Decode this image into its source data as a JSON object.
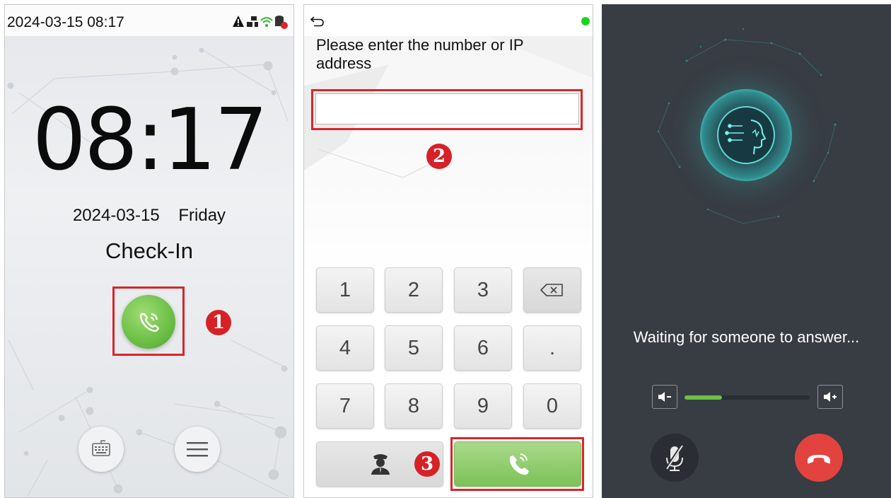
{
  "panel1": {
    "status_datetime": "2024-03-15 08:17",
    "status_icons": [
      "warning-icon",
      "network-icon",
      "wifi-icon",
      "database-icon"
    ],
    "clock": "08:17",
    "date": "2024-03-15",
    "weekday": "Friday",
    "mode": "Check-In",
    "call_icon": "phone-call-icon",
    "bottom_buttons": [
      "keyboard-icon",
      "menu-icon"
    ]
  },
  "panel2": {
    "back_icon": "back-arrow-icon",
    "status_color": "#1bd51b",
    "prompt": "Please enter the number or IP address",
    "input_value": "",
    "keys": [
      "1",
      "2",
      "3",
      "⌫",
      "4",
      "5",
      "6",
      ".",
      "7",
      "8",
      "9",
      "0"
    ],
    "guard_icon": "security-guard-icon",
    "call_icon": "phone-call-icon"
  },
  "panel3": {
    "waiting_text": "Waiting for someone to answer...",
    "volume_level": 0.3,
    "mute_icon": "microphone-muted-icon",
    "hangup_icon": "hang-up-icon"
  },
  "annotations": [
    "1",
    "2",
    "3"
  ]
}
